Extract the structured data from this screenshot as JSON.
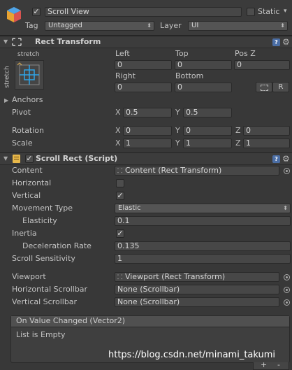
{
  "gameobject": {
    "name": "Scroll View",
    "enabled": true,
    "static_label": "Static",
    "tag_label": "Tag",
    "tag_value": "Untagged",
    "layer_label": "Layer",
    "layer_value": "UI"
  },
  "rect_transform": {
    "title": "Rect Transform",
    "anchor_preset_top": "stretch",
    "anchor_preset_side": "stretch",
    "left_label": "Left",
    "left_value": "0",
    "top_label": "Top",
    "top_value": "0",
    "posz_label": "Pos Z",
    "posz_value": "0",
    "right_label": "Right",
    "right_value": "0",
    "bottom_label": "Bottom",
    "bottom_value": "0",
    "raw_button": "R",
    "anchors_label": "Anchors",
    "pivot_label": "Pivot",
    "pivot_x": "0.5",
    "pivot_y": "0.5",
    "rotation_label": "Rotation",
    "rotation_x": "0",
    "rotation_y": "0",
    "rotation_z": "0",
    "scale_label": "Scale",
    "scale_x": "1",
    "scale_y": "1",
    "scale_z": "1",
    "axis_x": "X",
    "axis_y": "Y",
    "axis_z": "Z"
  },
  "scroll_rect": {
    "title": "Scroll Rect (Script)",
    "enabled": true,
    "content_label": "Content",
    "content_value": "Content (Rect Transform)",
    "horizontal_label": "Horizontal",
    "horizontal_checked": false,
    "vertical_label": "Vertical",
    "vertical_checked": true,
    "movement_type_label": "Movement Type",
    "movement_type_value": "Elastic",
    "elasticity_label": "Elasticity",
    "elasticity_value": "0.1",
    "inertia_label": "Inertia",
    "inertia_checked": true,
    "deceleration_label": "Deceleration Rate",
    "deceleration_value": "0.135",
    "scroll_sensitivity_label": "Scroll Sensitivity",
    "scroll_sensitivity_value": "1",
    "viewport_label": "Viewport",
    "viewport_value": "Viewport (Rect Transform)",
    "h_scrollbar_label": "Horizontal Scrollbar",
    "h_scrollbar_value": "None (Scrollbar)",
    "v_scrollbar_label": "Vertical Scrollbar",
    "v_scrollbar_value": "None (Scrollbar)",
    "event_title": "On Value Changed (Vector2)",
    "event_empty": "List is Empty",
    "add_button": "+",
    "remove_button": "-"
  },
  "watermark": "https://blog.csdn.net/minami_takumi",
  "colors": {
    "panel_bg": "#383838",
    "header_bg": "#3c3c3c",
    "field_bg": "#474747",
    "text": "#c4c4c4"
  }
}
